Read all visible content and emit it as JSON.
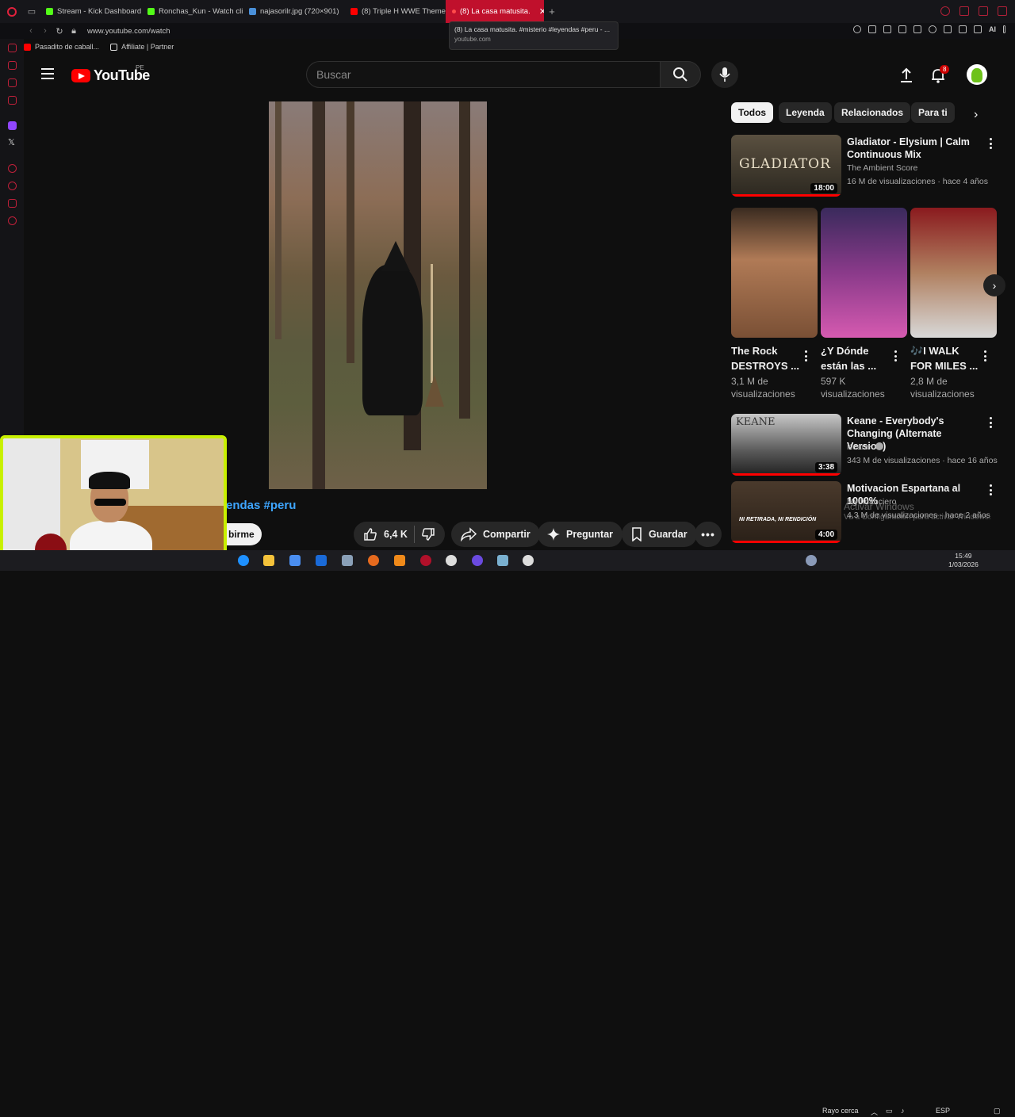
{
  "browser": {
    "tabs": [
      {
        "title": "Stream - Kick Dashboard",
        "favicon_color": "#53fc18"
      },
      {
        "title": "Ronchas_Kun - Watch clip",
        "favicon_color": "#53fc18"
      },
      {
        "title": "najasorilr.jpg (720×901)",
        "favicon_color": "#4a90d9"
      },
      {
        "title": "(8) Triple H WWE Theme",
        "favicon_color": "#ff0000"
      },
      {
        "title": "(8) La casa matusita.",
        "favicon_color": "#ffffff",
        "active": true
      }
    ],
    "url": "www.youtube.com/watch",
    "tooltip": {
      "title": "(8) La casa matusita. #misterio #leyendas #peru - ...",
      "domain": "youtube.com"
    },
    "bookmarks": [
      {
        "label": "Pasadito de caball...",
        "favicon_color": "#ff0000"
      },
      {
        "label": "Affiliate | Partner",
        "favicon_color": "#dddddd"
      }
    ],
    "ai_label": "AI"
  },
  "youtube": {
    "logo_text": "YouTube",
    "country_code": "PE",
    "search_placeholder": "Buscar",
    "notification_count": "8",
    "video": {
      "title_fragment": "endas #peru",
      "subscribe_fragment": "birme",
      "likes": "6,4 K",
      "share_label": "Compartir",
      "ask_label": "Preguntar",
      "save_label": "Guardar"
    },
    "chips": [
      "Todos",
      "Leyenda",
      "Relacionados",
      "Para ti"
    ],
    "recommendations": [
      {
        "title": "Gladiator - Elysium | Calm Continuous Mix",
        "channel": "The Ambient Score",
        "stats": "16 M de visualizaciones · hace 4 años",
        "duration": "18:00",
        "thumb_text": "GLADIATOR"
      },
      {
        "title": "Keane - Everybody's Changing (Alternate Version)",
        "channel": "Keane",
        "stats": "343 M de visualizaciones · hace 16 años",
        "duration": "3:38",
        "thumb_text": "KEANE"
      },
      {
        "title": "Motivacion Espartana al 1000%",
        "channel": "My financiero",
        "stats": "4,3 M de visualizaciones · hace 2 años",
        "duration": "4:00",
        "thumb_text": "NI RETIRADA, NI RENDICIÓN"
      }
    ],
    "shorts": [
      {
        "title": "The Rock DESTROYS ...",
        "views": "3,1 M de visualizaciones"
      },
      {
        "title": "¿Y Dónde están las ...",
        "views": "597 K visualizaciones"
      },
      {
        "title": "🎶I WALK FOR MILES ...",
        "views": "2,8 M de visualizaciones"
      }
    ]
  },
  "watermark": {
    "line1": "Activar Windows",
    "line2": "Ve a Configuración para activar Windows."
  },
  "taskbar": {
    "weather": "Rayo cerca",
    "lang": "ESP",
    "time": "15:49",
    "date": "1/03/2026"
  }
}
